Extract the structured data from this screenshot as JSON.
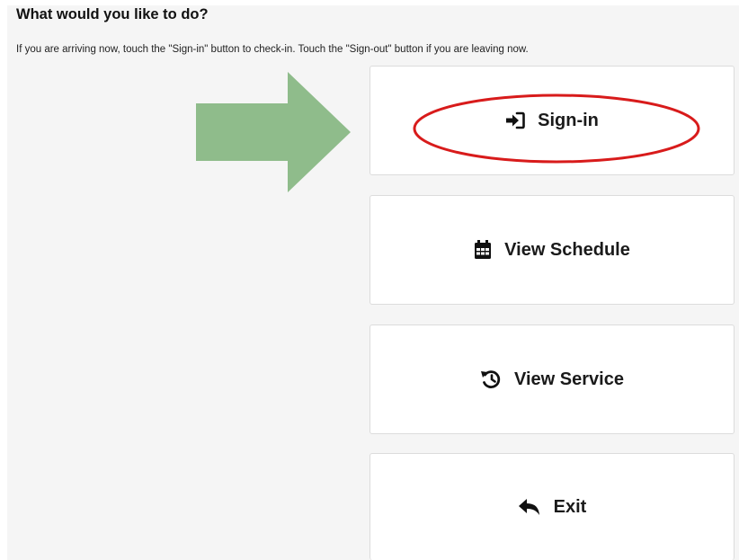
{
  "header": {
    "title": "What would you like to do?",
    "description": "If you are arriving now, touch the \"Sign-in\" button to check-in. Touch the \"Sign-out\" button if you are leaving now."
  },
  "actions": [
    {
      "label": "Sign-in",
      "icon": "sign-in-icon"
    },
    {
      "label": "View Schedule",
      "icon": "calendar-icon"
    },
    {
      "label": "View Service",
      "icon": "history-icon"
    },
    {
      "label": "Exit",
      "icon": "reply-icon"
    }
  ],
  "annotations": {
    "arrow_color": "#8fbc8b",
    "highlight_color": "#d81b1b"
  }
}
